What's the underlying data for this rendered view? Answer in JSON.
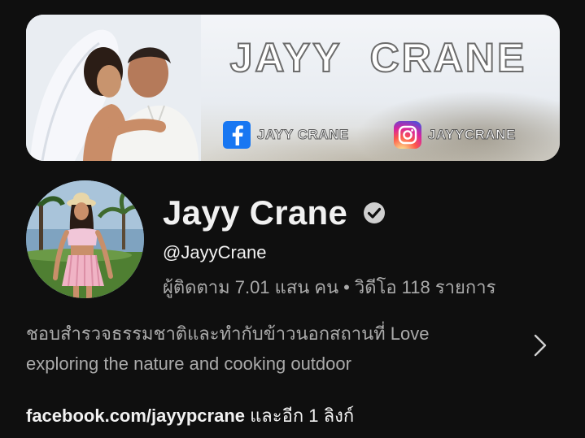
{
  "banner": {
    "title": "JAYY  CRANE",
    "facebook_handle": "JAYY CRANE",
    "instagram_handle": "JAYYCRANE"
  },
  "channel": {
    "name": "Jayy Crane",
    "verified": true,
    "handle": "@JayyCrane",
    "subscribers": "ผู้ติดตาม 7.01 แสน คน",
    "separator": "•",
    "videos": "วิดีโอ 118 รายการ",
    "description": "ชอบสำรวจธรรมชาติและทำกับข้าวนอกสถานที่ Love exploring the nature and cooking outdoor",
    "link_url": "facebook.com/jayypcrane",
    "link_more": " และอีก 1 ลิงก์"
  },
  "colors": {
    "background": "#0f0f0f",
    "primary_text": "#f1f1f1",
    "secondary_text": "#aaaaaa"
  }
}
